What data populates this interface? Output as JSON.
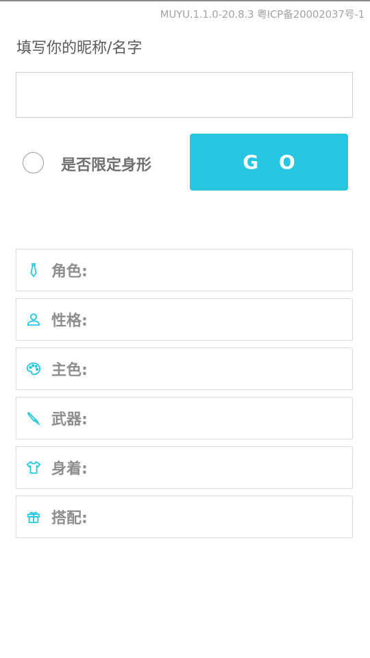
{
  "header": {
    "version_text": "MUYU.1.1.0-20.8.3 粤ICP备20002037号-1"
  },
  "form": {
    "nickname_label": "填写你的昵称/名字",
    "nickname_value": "",
    "limit_body_label": "是否限定身形",
    "limit_body_checked": false,
    "go_label": "G O"
  },
  "results": [
    {
      "label": "角色:",
      "value": "",
      "icon": "tie-icon"
    },
    {
      "label": "性格:",
      "value": "",
      "icon": "person-icon"
    },
    {
      "label": "主色:",
      "value": "",
      "icon": "palette-icon"
    },
    {
      "label": "武器:",
      "value": "",
      "icon": "brush-icon"
    },
    {
      "label": "身着:",
      "value": "",
      "icon": "shirt-icon"
    },
    {
      "label": "搭配:",
      "value": "",
      "icon": "gift-icon"
    }
  ],
  "colors": {
    "accent": "#26c6e0",
    "icon": "#26c6e0",
    "border": "#dcdcdc",
    "label_text": "#8e8e8e"
  }
}
